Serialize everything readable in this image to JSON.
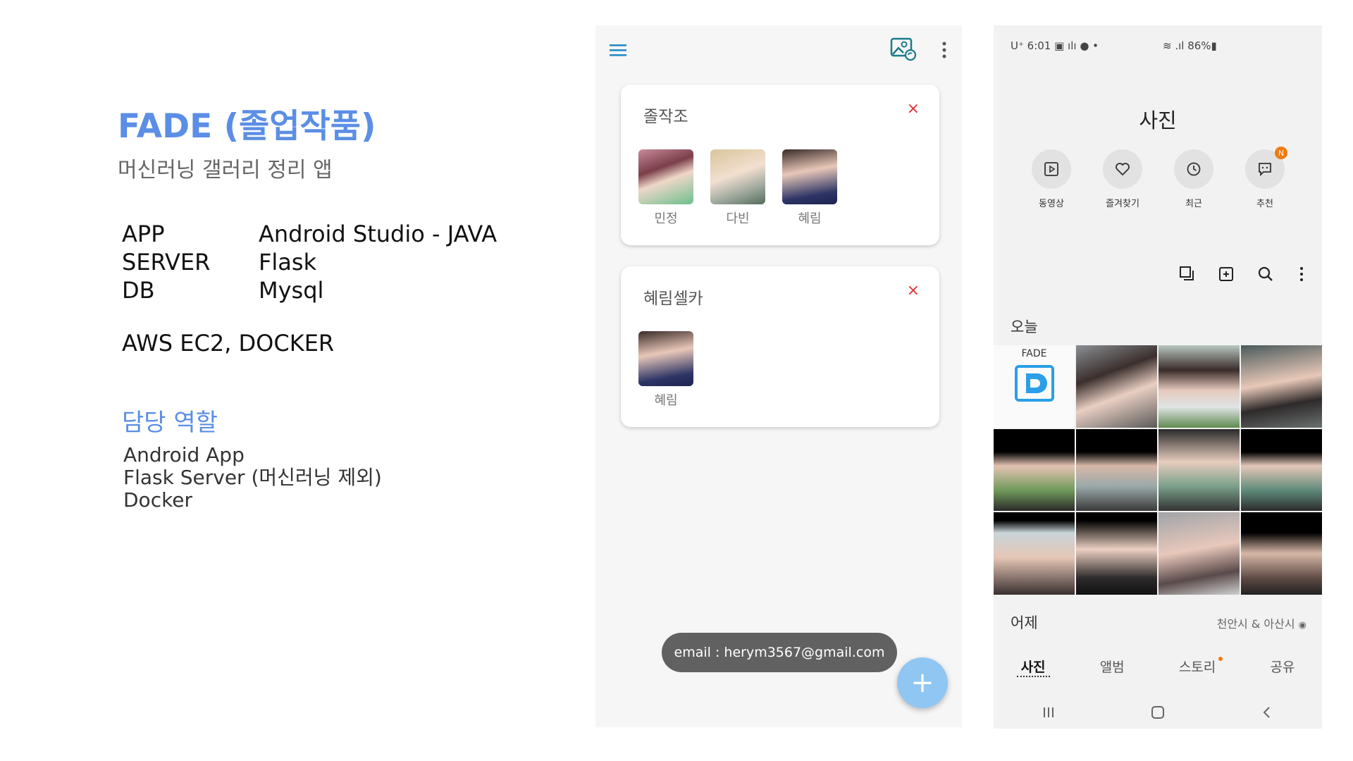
{
  "slide": {
    "title": "FADE (졸업작품)",
    "subtitle": "머신러닝 갤러리 정리 앱",
    "stack": [
      {
        "key": "APP",
        "value": "Android Studio - JAVA"
      },
      {
        "key": "SERVER",
        "value": "Flask"
      },
      {
        "key": "DB",
        "value": "Mysql"
      }
    ],
    "infra": "AWS EC2, DOCKER",
    "role_title": "담당 역할",
    "roles": [
      "Android App",
      "Flask Server (머신러닝 제외)",
      "Docker"
    ]
  },
  "app": {
    "cards": [
      {
        "title": "졸작조",
        "close": "×",
        "people": [
          "민정",
          "다빈",
          "혜림"
        ]
      },
      {
        "title": "혜림셀카",
        "close": "×",
        "people": [
          "혜림"
        ]
      }
    ],
    "toast": "email : herym3567@gmail.com",
    "fab": "+",
    "icons": {
      "menu": "menu-icon",
      "gallery": "gallery-sync-icon",
      "more": "more-vert-icon"
    },
    "accent": "#1e88c8"
  },
  "phone": {
    "status_left": "U⁺ 6:01 ▣ ılı ● •",
    "status_right": "≋ .ıl 86%▮",
    "title": "사진",
    "quick": [
      {
        "label": "동영상",
        "icon": "video-icon"
      },
      {
        "label": "즐겨찾기",
        "icon": "heart-icon"
      },
      {
        "label": "최근",
        "icon": "clock-icon"
      },
      {
        "label": "추천",
        "icon": "suggest-icon",
        "badge": "N"
      }
    ],
    "today": "오늘",
    "yesterday": "어제",
    "location": "천안시 & 아산시",
    "fade_thumb_title": "FADE",
    "tabs": [
      "사진",
      "앨범",
      "스토리",
      "공유"
    ],
    "active_tab": "사진",
    "badge_color": "#f07a10"
  }
}
